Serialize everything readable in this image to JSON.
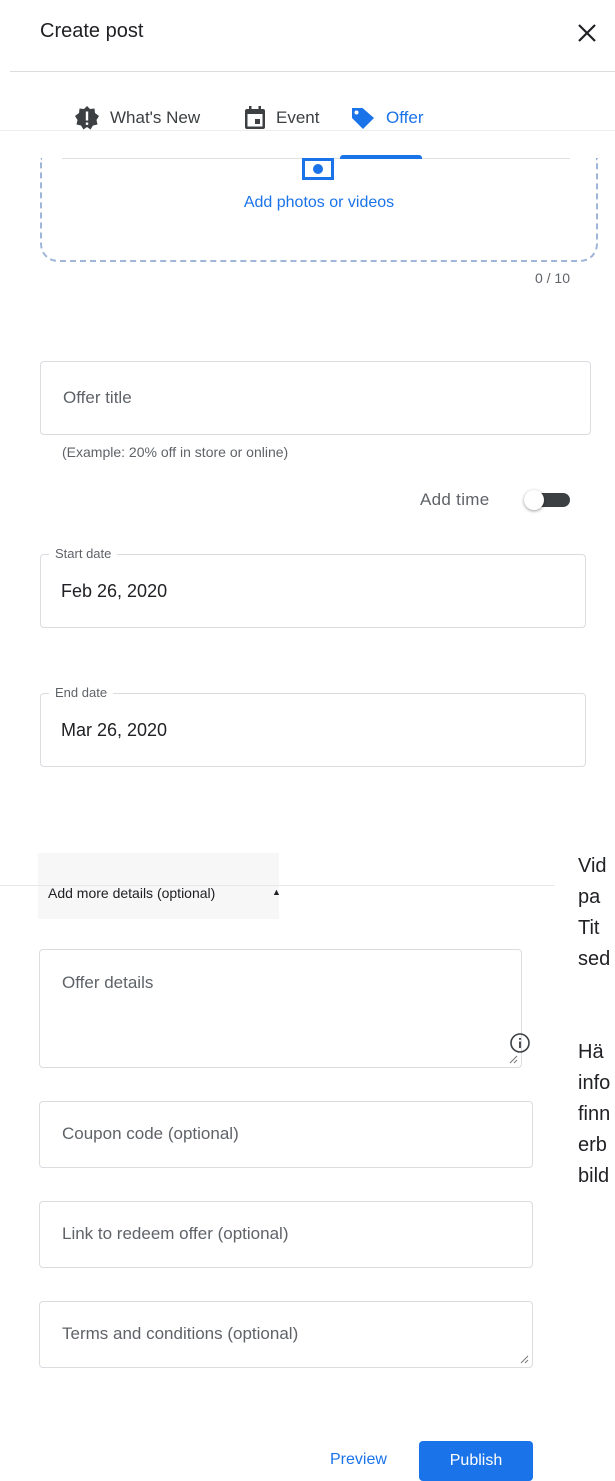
{
  "header": {
    "title": "Create post"
  },
  "tabs": [
    {
      "label": "What's New",
      "icon": "alert-badge-icon"
    },
    {
      "label": "Event",
      "icon": "calendar-icon"
    },
    {
      "label": "Offer",
      "icon": "tag-icon"
    }
  ],
  "active_tab": "Offer",
  "media": {
    "add_label": "Add photos or videos",
    "counter": "0 / 10"
  },
  "offer_title": {
    "placeholder": "Offer title",
    "helper": "(Example: 20% off in store or online)"
  },
  "add_time": {
    "label": "Add time",
    "enabled": false
  },
  "start_date": {
    "label": "Start date",
    "value": "Feb 26, 2020"
  },
  "end_date": {
    "label": "End date",
    "value": "Mar 26, 2020"
  },
  "details": {
    "toggle_label": "Add more details (optional)",
    "offer_details_placeholder": "Offer details",
    "coupon_placeholder": "Coupon code (optional)",
    "link_placeholder": "Link to redeem offer (optional)",
    "terms_placeholder": "Terms and conditions (optional)"
  },
  "side_text": [
    "Vid",
    "pa",
    "Tit",
    "sed",
    "",
    "Hä",
    "info",
    "finn",
    "erb",
    "bild"
  ],
  "actions": {
    "preview": "Preview",
    "publish": "Publish"
  },
  "colors": {
    "accent": "#1a73e8",
    "border": "#dadce0",
    "text_secondary": "#5f6368"
  }
}
